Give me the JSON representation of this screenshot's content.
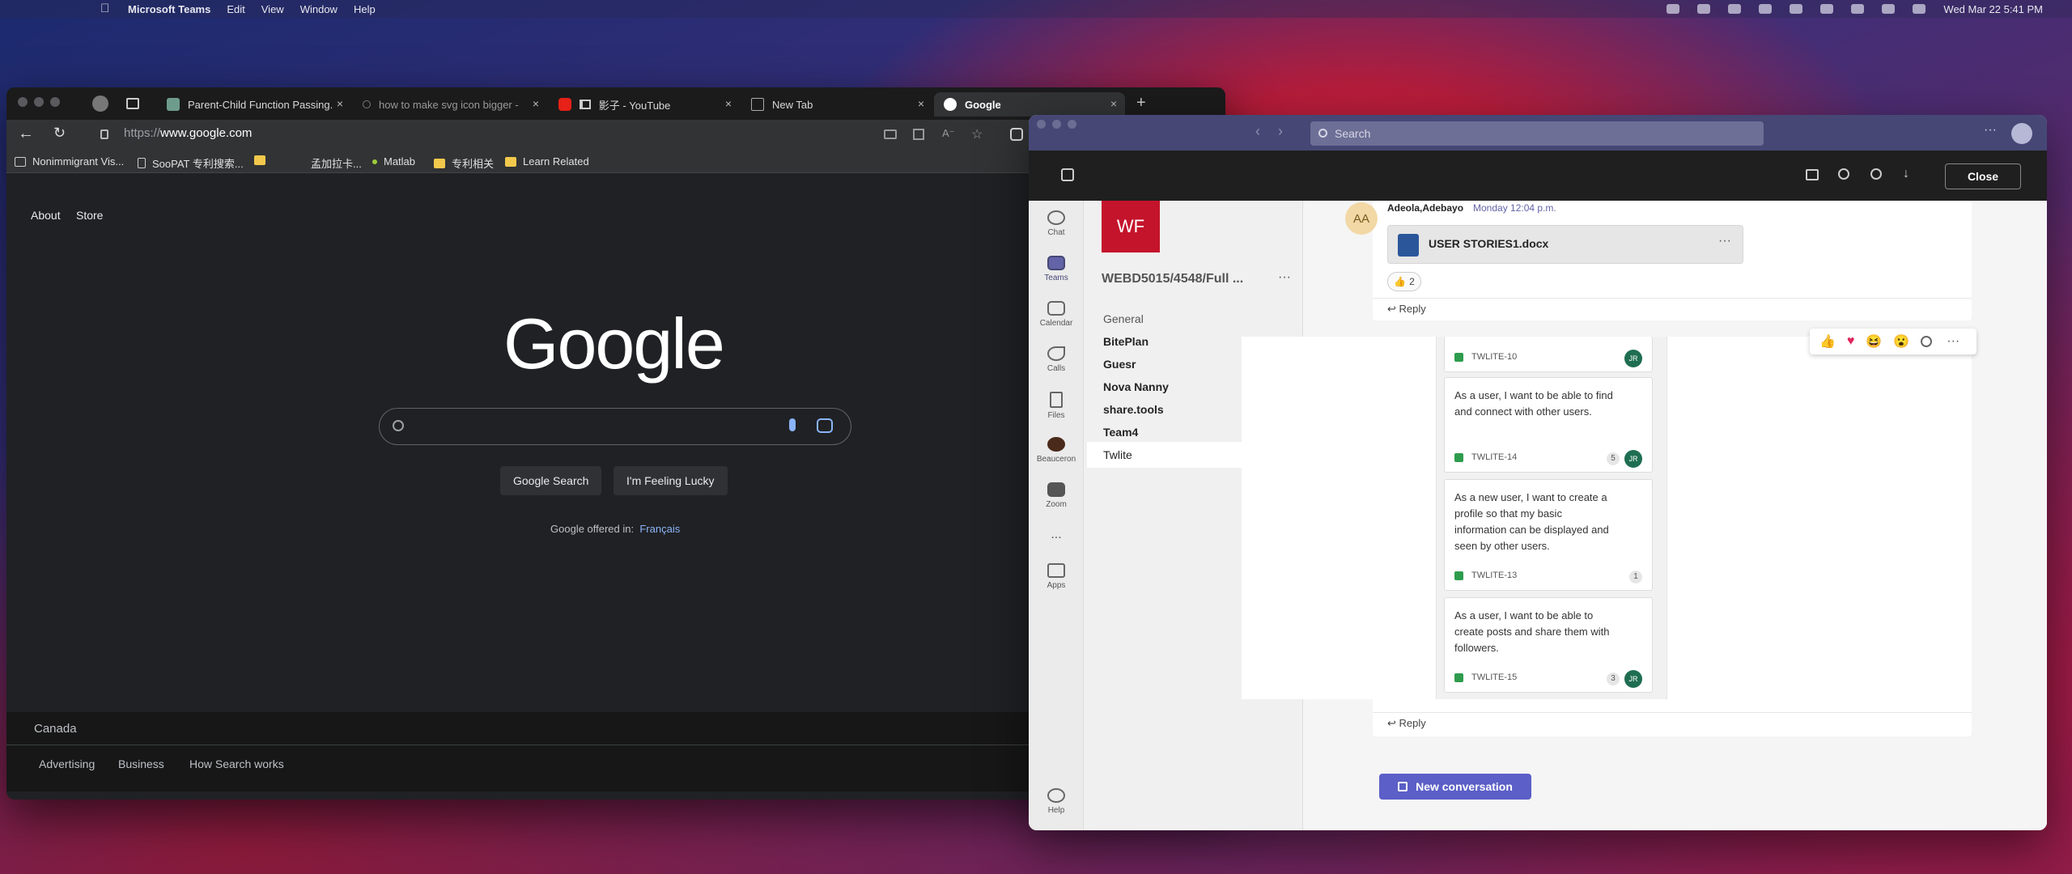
{
  "menubar": {
    "app": "Microsoft Teams",
    "items": [
      "Edit",
      "View",
      "Window",
      "Help"
    ],
    "clock": "Wed Mar 22  5:41 PM"
  },
  "browser": {
    "tabs": [
      {
        "label": "Parent-Child Function Passing.",
        "icon": "chatgpt-icon"
      },
      {
        "label": "how to make svg icon bigger -",
        "icon": "search-icon"
      },
      {
        "label": "影子 - YouTube",
        "icon": "youtube-icon"
      },
      {
        "label": "New Tab",
        "icon": "newtab-icon"
      },
      {
        "label": "Google",
        "icon": "google-icon"
      }
    ],
    "url_prefix": "https://",
    "url_host": "www.google.com",
    "bookmarks": [
      "Nonimmigrant Vis...",
      "SooPAT 专利搜索...",
      "",
      "孟加拉卡...",
      "Matlab",
      "专利相关",
      "Learn Related"
    ]
  },
  "google": {
    "top_links": [
      "About",
      "Store"
    ],
    "logo": "Google",
    "buttons": [
      "Google Search",
      "I'm Feeling Lucky"
    ],
    "offered_in": "Google offered in:",
    "offered_lang": "Français",
    "country": "Canada",
    "footer_links": [
      "Advertising",
      "Business",
      "How Search works"
    ]
  },
  "teams": {
    "search_placeholder": "Search",
    "close_label": "Close",
    "rail": [
      "Chat",
      "Teams",
      "Calendar",
      "Calls",
      "Files",
      "Beauceron",
      "Zoom",
      "...",
      "Apps",
      "Help"
    ],
    "team_initials": "WF",
    "team_name": "WEBD5015/4548/Full ...",
    "channels": [
      "General",
      "BitePlan",
      "Guesr",
      "Nova Nanny",
      "share.tools",
      "Team4",
      "Twlite"
    ],
    "post": {
      "avatar": "AA",
      "author": "Adeola,Adebayo",
      "time": "Monday 12:04 p.m.",
      "file": "USER STORIES1.docx",
      "reaction_count": "2",
      "reply": "Reply"
    },
    "reply2": "Reply",
    "new_conversation": "New conversation",
    "colors": {
      "accent": "#464775",
      "button": "#5b5fc7",
      "team_tile": "#c4142b"
    }
  },
  "board": {
    "cards": [
      {
        "text": "",
        "key": "TWLITE-10",
        "count": "",
        "assignee": "JR"
      },
      {
        "text": "As a user, I want to be able to find and connect with other users.",
        "key": "TWLITE-14",
        "count": "5",
        "assignee": "JR"
      },
      {
        "text": "As a new user, I want to create a profile so that my basic information can be displayed and seen by other users.",
        "key": "TWLITE-13",
        "count": "1",
        "assignee": ""
      },
      {
        "text": "As a user, I want to be able to create posts and share them with followers.",
        "key": "TWLITE-15",
        "count": "3",
        "assignee": "JR"
      }
    ]
  }
}
